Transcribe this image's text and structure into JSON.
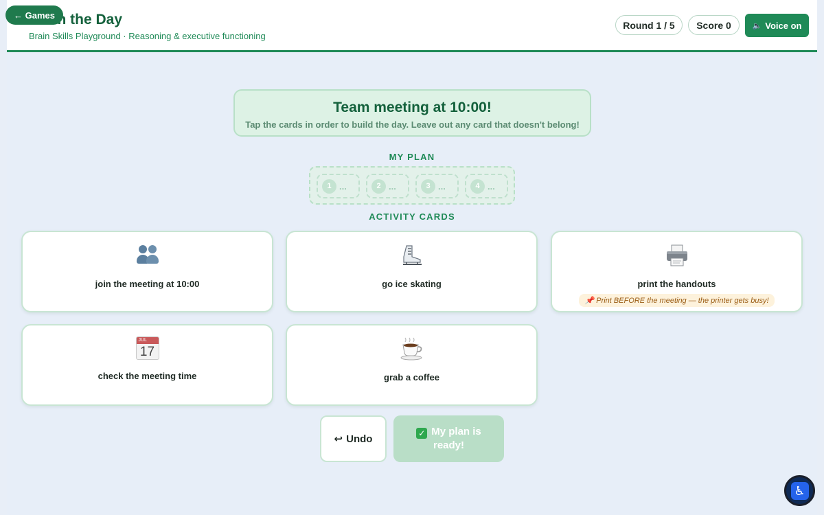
{
  "header": {
    "back_label": "← Games",
    "title": "Plan the Day",
    "subtitle": "Brain Skills Playground · Reasoning & executive functioning",
    "round": "Round 1 / 5",
    "score": "Score 0",
    "voice_label": "Voice on",
    "voice_icon": "speaker-icon"
  },
  "banner": {
    "title": "Team meeting at 10:00!",
    "instruction": "Tap the cards in order to build the day. Leave out any card that doesn't belong!"
  },
  "plan": {
    "label": "MY PLAN",
    "slots": [
      {
        "num": "1",
        "text": "..."
      },
      {
        "num": "2",
        "text": "..."
      },
      {
        "num": "3",
        "text": "..."
      },
      {
        "num": "4",
        "text": "..."
      }
    ]
  },
  "cards": {
    "label": "ACTIVITY CARDS",
    "items": [
      {
        "icon": "people-icon",
        "label": "join the meeting at 10:00"
      },
      {
        "icon": "ice-skate-icon",
        "label": "go ice skating"
      },
      {
        "icon": "printer-icon",
        "label": "print the handouts",
        "hint": "📌 Print BEFORE the meeting — the printer gets busy!"
      },
      {
        "icon": "calendar-icon",
        "label": "check the meeting time",
        "calendar_month": "JUL",
        "calendar_day": "17"
      },
      {
        "icon": "coffee-icon",
        "label": "grab a coffee"
      }
    ]
  },
  "actions": {
    "undo_label": "Undo",
    "undo_icon": "↩",
    "ready_label": "My plan is ready!",
    "ready_icon": "✓"
  },
  "accessibility": {
    "icon": "♿"
  },
  "colors": {
    "brand_green": "#1f8a57",
    "dark_green": "#14613c",
    "background": "#e8eef7",
    "banner_bg": "#ddf2e5",
    "ready_disabled": "#b9dec7",
    "hint_bg": "#fdf2dc"
  }
}
